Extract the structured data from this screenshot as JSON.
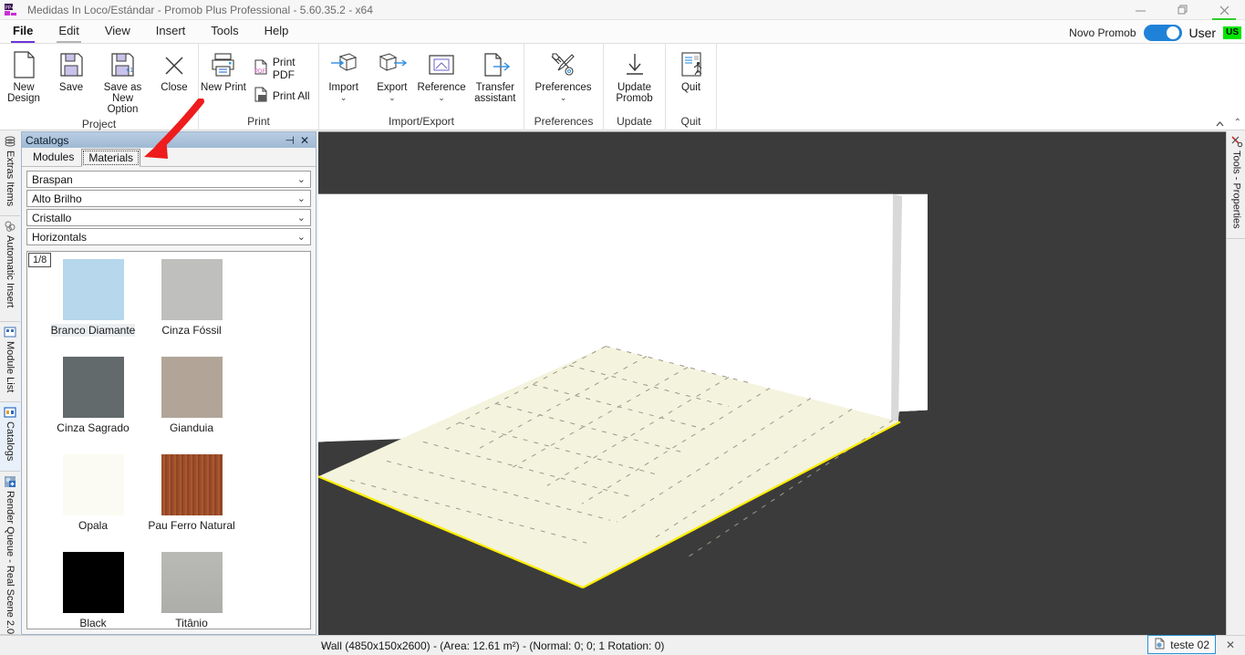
{
  "window": {
    "title": "Medidas In Loco/Estándar - Promob Plus Professional - 5.60.35.2 - x64",
    "logo_text": "PP+",
    "minimize": "—",
    "maximize": "❐",
    "close": "✕"
  },
  "menubar": {
    "items": [
      {
        "label": "File",
        "state": "active"
      },
      {
        "label": "Edit",
        "state": "hover"
      },
      {
        "label": "View",
        "state": "normal"
      },
      {
        "label": "Insert",
        "state": "normal"
      },
      {
        "label": "Tools",
        "state": "normal"
      },
      {
        "label": "Help",
        "state": "normal"
      }
    ],
    "novo_promob_label": "Novo Promob",
    "toggle_state": "on",
    "user_label": "User",
    "user_badge": "US",
    "badge_color": "#00e500",
    "accent_color": "#6b35d6",
    "toggle_color": "#1f82d8"
  },
  "ribbon": {
    "collapse_icon": "⌃",
    "groups": [
      {
        "title": "Project",
        "buttons": [
          {
            "label": "New Design",
            "icon": "new-document-icon"
          },
          {
            "label": "Save",
            "icon": "save-disk-icon"
          },
          {
            "label": "Save as New Option",
            "icon": "save-as-new-icon"
          },
          {
            "label": "Close",
            "icon": "close-x-icon"
          }
        ]
      },
      {
        "title": "Print",
        "buttons": [
          {
            "label": "New Print",
            "icon": "printer-icon"
          }
        ],
        "small_buttons": [
          {
            "label": "Print PDF",
            "icon": "pdf-icon"
          },
          {
            "label": "Print All",
            "icon": "print-all-icon"
          }
        ]
      },
      {
        "title": "Import/Export",
        "buttons": [
          {
            "label": "Import",
            "icon": "cube-import-icon",
            "chevron": "⌄"
          },
          {
            "label": "Export",
            "icon": "cube-export-icon",
            "chevron": "⌄"
          },
          {
            "label": "Reference",
            "icon": "reference-frame-icon",
            "chevron": "⌄"
          },
          {
            "label": "Transfer assistant",
            "icon": "transfer-document-icon"
          }
        ]
      },
      {
        "title": "Preferences",
        "buttons": [
          {
            "label": "Preferences",
            "icon": "tools-wrench-icon",
            "chevron": "⌄"
          }
        ]
      },
      {
        "title": "Update",
        "buttons": [
          {
            "label": "Update Promob",
            "icon": "download-arrow-icon"
          }
        ]
      },
      {
        "title": "Quit",
        "buttons": [
          {
            "label": "Quit",
            "icon": "exit-door-icon"
          }
        ]
      }
    ]
  },
  "left_tabs": [
    {
      "label": "Extras Items",
      "icon": "stack-icon",
      "selected": false
    },
    {
      "label": "Automatic Insert",
      "icon": "auto-insert-icon",
      "selected": false
    },
    {
      "label": "Module List",
      "icon": "module-list-icon",
      "selected": false
    },
    {
      "label": "Catalogs",
      "icon": "catalogs-icon",
      "selected": true
    },
    {
      "label": "Render Queue - Real Scene 2.0",
      "icon": "render-queue-icon",
      "selected": false
    }
  ],
  "right_tabs": [
    {
      "label": "Tools - Properties",
      "icon": "tools-properties-icon"
    }
  ],
  "catalogs_panel": {
    "title": "Catalogs",
    "pin_icon": "⊣",
    "close_icon": "✕",
    "tabs": [
      {
        "label": "Modules",
        "active": false
      },
      {
        "label": "Materials",
        "active": true
      }
    ],
    "filters": [
      {
        "value": "Braspan",
        "arrow": "⌄"
      },
      {
        "value": "Alto Brilho",
        "arrow": "⌄"
      },
      {
        "value": "Cristallo",
        "arrow": "⌄"
      },
      {
        "value": "Horizontals",
        "arrow": "⌄"
      }
    ],
    "page_badge": "1/8",
    "swatches": [
      {
        "name": "Branco Diamante",
        "color": "#b6d7ec",
        "selected": true
      },
      {
        "name": "Cinza Fóssil",
        "color": "#bfbfbd",
        "selected": false
      },
      {
        "name": "Cinza Sagrado",
        "color": "#636a6c",
        "selected": false
      },
      {
        "name": "Gianduia",
        "color": "#b2a598",
        "selected": false
      },
      {
        "name": "Opala",
        "color": "#fbfbf3",
        "selected": false
      },
      {
        "name": "Pau Ferro Natural",
        "color": "#a0512a",
        "selected": false
      },
      {
        "name": "Black",
        "color": "#000000",
        "selected": false
      },
      {
        "name": "Titânio",
        "color": "#b5b5b1",
        "selected": false
      }
    ]
  },
  "viewport": {
    "background": "#3b3b3b",
    "wall_color": "#ffffff",
    "wall_edge_color": "#d8d8d8",
    "floor_color": "#f2f1da",
    "selection_color": "#ffee00",
    "grid_color": "#9a9a8c"
  },
  "statusbar": {
    "caret": "›",
    "text": "Wall (4850x150x2600) - (Area: 12.61 m²) - (Normal: 0; 0; 1 Rotation: 0)",
    "doc_tab": {
      "label": "teste 02",
      "icon": "document-icon",
      "close": "✕"
    },
    "close_icon": "✕"
  },
  "annotation": {
    "arrow_color": "#ee1c1c",
    "points_to": "Materials tab"
  }
}
